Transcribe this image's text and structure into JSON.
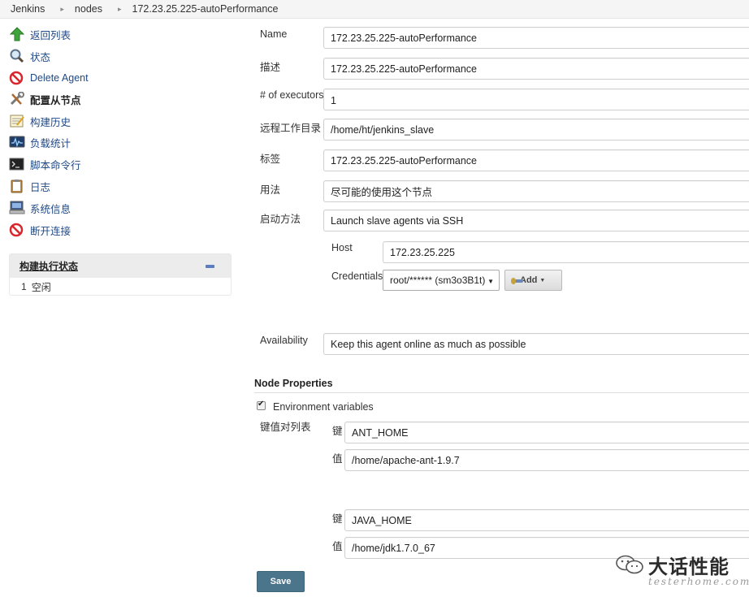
{
  "breadcrumb": [
    "Jenkins",
    "nodes",
    "172.23.25.225-autoPerformance"
  ],
  "sidebar": {
    "items": [
      {
        "label": "返回列表",
        "icon": "up-arrow-icon"
      },
      {
        "label": "状态",
        "icon": "magnifier-icon"
      },
      {
        "label": "Delete Agent",
        "icon": "no-entry-icon"
      },
      {
        "label": "配置从节点",
        "icon": "tools-icon"
      },
      {
        "label": "构建历史",
        "icon": "notepad-icon"
      },
      {
        "label": "负载统计",
        "icon": "monitor-graph-icon"
      },
      {
        "label": "脚本命令行",
        "icon": "terminal-icon"
      },
      {
        "label": "日志",
        "icon": "clipboard-icon"
      },
      {
        "label": "系统信息",
        "icon": "computer-icon"
      },
      {
        "label": "断开连接",
        "icon": "no-entry-icon"
      }
    ],
    "active_index": 3
  },
  "executor": {
    "title": "构建执行状态",
    "rows": [
      {
        "num": "1",
        "status": "空闲"
      }
    ]
  },
  "form": {
    "name": {
      "label": "Name",
      "value": "172.23.25.225-autoPerformance"
    },
    "description": {
      "label": "描述",
      "value": "172.23.25.225-autoPerformance"
    },
    "executors": {
      "label": "# of executors",
      "value": "1"
    },
    "remote_dir": {
      "label": "远程工作目录",
      "value": "/home/ht/jenkins_slave"
    },
    "labels": {
      "label": "标签",
      "value": "172.23.25.225-autoPerformance"
    },
    "usage": {
      "label": "用法",
      "value": "尽可能的使用这个节点"
    },
    "launch": {
      "label": "启动方法",
      "value": "Launch slave agents via SSH"
    },
    "host": {
      "label": "Host",
      "value": "172.23.25.225"
    },
    "credentials": {
      "label": "Credentials",
      "value": "root/****** (sm3o3B1t)",
      "add_label": "Add"
    },
    "availability": {
      "label": "Availability",
      "value": "Keep this agent online as much as possible"
    }
  },
  "node_properties": {
    "title": "Node Properties",
    "env_checkbox_label": "Environment variables",
    "env_checked": true,
    "kv_label": "键值对列表",
    "key_label": "键",
    "value_label": "值",
    "entries": [
      {
        "key": "ANT_HOME",
        "value": "/home/apache-ant-1.9.7"
      },
      {
        "key": "JAVA_HOME",
        "value": "/home/jdk1.7.0_67"
      }
    ]
  },
  "save_label": "Save",
  "watermark": {
    "title": "大话性能",
    "subtitle": "testerhome.com"
  },
  "colors": {
    "link": "#204a87",
    "save_button": "#4b758b",
    "breadcrumb_bg": "#f5f5f5"
  }
}
